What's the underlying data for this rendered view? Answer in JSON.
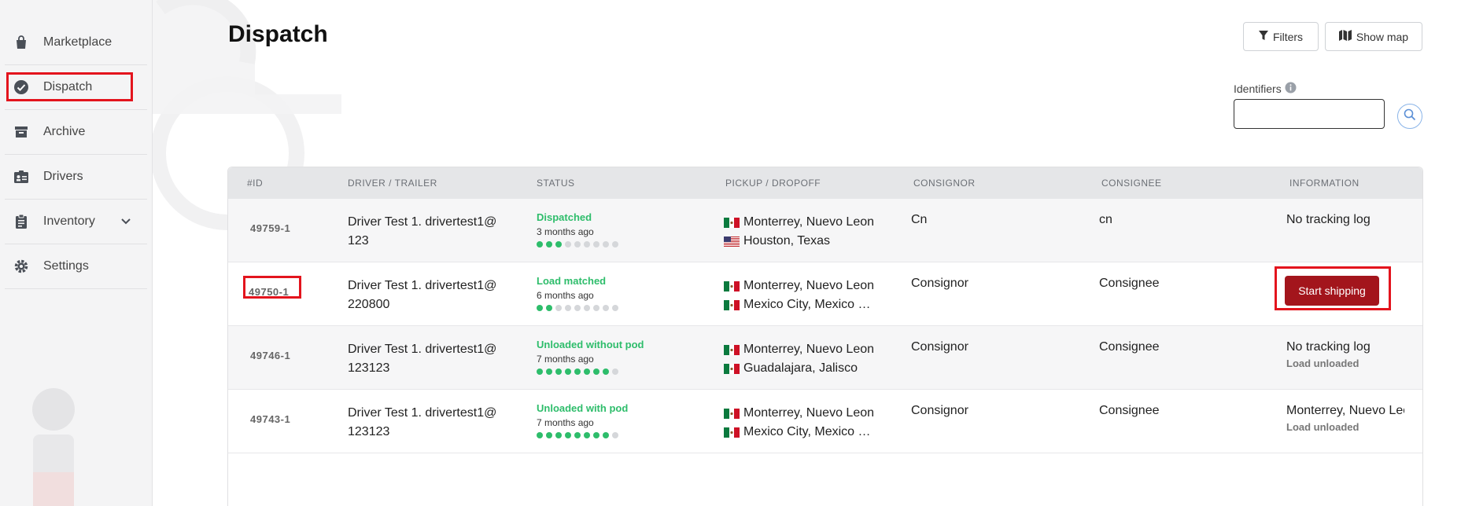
{
  "sidebar": {
    "items": [
      {
        "label": "Marketplace",
        "icon": "bag-icon"
      },
      {
        "label": "Dispatch",
        "icon": "check-circle-icon",
        "active": true
      },
      {
        "label": "Archive",
        "icon": "archive-icon"
      },
      {
        "label": "Drivers",
        "icon": "id-card-icon"
      },
      {
        "label": "Inventory",
        "icon": "clipboard-icon",
        "expandable": true
      },
      {
        "label": "Settings",
        "icon": "gear-icon"
      }
    ]
  },
  "header": {
    "title": "Dispatch",
    "filters_label": "Filters",
    "map_label": "Show map"
  },
  "search": {
    "identifiers_label": "Identifiers",
    "value": "",
    "placeholder": ""
  },
  "table": {
    "columns": [
      "#ID",
      "DRIVER / TRAILER",
      "STATUS",
      "PICKUP / DROPOFF",
      "CONSIGNOR",
      "CONSIGNEE",
      "INFORMATION"
    ],
    "rows": [
      {
        "id": "49759-1",
        "driver_line1": "Driver Test 1. drivertest1@",
        "driver_line2": "123",
        "status": "Dispatched",
        "ago": "3 months ago",
        "progress_steps_done": 3,
        "progress_steps_total": 9,
        "pickup": "Monterrey, Nuevo Leon",
        "pickup_flag": "mexico-flag",
        "dropoff": "Houston, Texas",
        "dropoff_flag": "usa-flag",
        "consignor": "Cn",
        "consignee": "cn",
        "info": "No tracking log",
        "info_sub": ""
      },
      {
        "id": "49750-1",
        "driver_line1": "Driver Test 1. drivertest1@",
        "driver_line2": "220800",
        "status": "Load matched",
        "ago": "6 months ago",
        "progress_steps_done": 2,
        "progress_steps_total": 9,
        "pickup": "Monterrey, Nuevo Leon",
        "pickup_flag": "mexico-flag",
        "dropoff": "Mexico City, Mexico …",
        "dropoff_flag": "mexico-flag",
        "consignor": "Consignor",
        "consignee": "Consignee",
        "action": "Start shipping"
      },
      {
        "id": "49746-1",
        "driver_line1": "Driver Test 1. drivertest1@",
        "driver_line2": "123123",
        "status": "Unloaded without pod",
        "ago": "7 months ago",
        "progress_steps_done": 8,
        "progress_steps_total": 9,
        "pickup": "Monterrey, Nuevo Leon",
        "pickup_flag": "mexico-flag",
        "dropoff": "Guadalajara, Jalisco",
        "dropoff_flag": "mexico-flag",
        "consignor": "Consignor",
        "consignee": "Consignee",
        "info": "No tracking log",
        "info_sub": "Load unloaded"
      },
      {
        "id": "49743-1",
        "driver_line1": "Driver Test 1. drivertest1@",
        "driver_line2": "123123",
        "status": "Unloaded with pod",
        "ago": "7 months ago",
        "progress_steps_done": 8,
        "progress_steps_total": 9,
        "pickup": "Monterrey, Nuevo Leon",
        "pickup_flag": "mexico-flag",
        "dropoff": "Mexico City, Mexico …",
        "dropoff_flag": "mexico-flag",
        "consignor": "Consignor",
        "consignee": "Consignee",
        "info": "Monterrey, Nuevo Leon",
        "info_sub": "Load unloaded"
      }
    ]
  },
  "colors": {
    "accent_red": "#a3151c",
    "highlight_red": "#e3141d",
    "status_green": "#2ebd6b"
  }
}
